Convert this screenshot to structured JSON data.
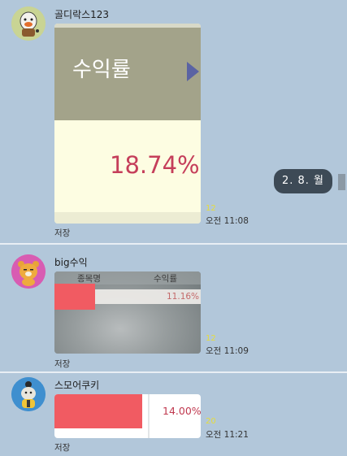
{
  "date_divider": "2. 8. 월",
  "messages": [
    {
      "sender": "골디락스123",
      "avatar": "muzi-guitar-avatar",
      "image": {
        "header_label": "수익률",
        "value": "18.74%"
      },
      "unread": "12",
      "time": "오전 11:08",
      "save_label": "저장"
    },
    {
      "sender": "big수익",
      "avatar": "ryan-avatar",
      "image": {
        "col1": "종목명",
        "col2": "수익률",
        "value": "11.16%"
      },
      "unread": "12",
      "time": "오전 11:09",
      "save_label": "저장"
    },
    {
      "sender": "스모어쿠키",
      "avatar": "cookie-avatar",
      "image": {
        "value": "14.00%"
      },
      "unread": "20",
      "time": "오전 11:21",
      "save_label": "저장"
    }
  ],
  "colors": {
    "background": "#b2c7da",
    "highlight": "#f15b62",
    "date_pill": "#3d4a56"
  }
}
